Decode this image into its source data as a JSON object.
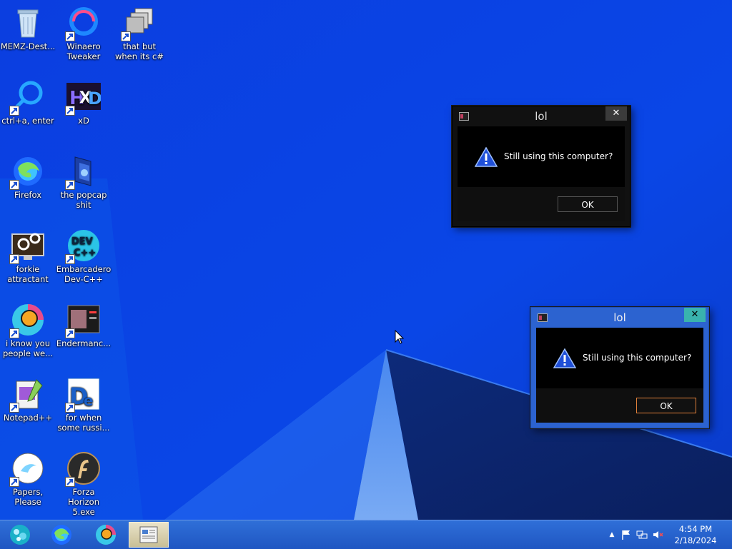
{
  "desktop": {
    "icons": [
      {
        "label": "MEMZ-Dest...",
        "icon": "recycle-bin-icon",
        "shortcut": false
      },
      {
        "label": "Winaero Tweaker",
        "icon": "winaero-tweaker-icon",
        "shortcut": true
      },
      {
        "label": "that but when its c#",
        "icon": "stacked-windows-icon",
        "shortcut": true
      },
      {
        "label": "ctrl+a, enter",
        "icon": "search-ring-icon",
        "shortcut": true
      },
      {
        "label": "xD",
        "icon": "hxd-icon",
        "shortcut": true
      },
      {
        "label": "Firefox",
        "icon": "firefox-icon",
        "shortcut": true
      },
      {
        "label": "the popcap shit",
        "icon": "popcap-folder-icon",
        "shortcut": true
      },
      {
        "label": "forkie attractant",
        "icon": "gear-monitor-icon",
        "shortcut": true
      },
      {
        "label": "Embarcadero Dev-C++",
        "icon": "devcpp-icon",
        "shortcut": true
      },
      {
        "label": "i know you people we...",
        "icon": "colorful-circle-icon",
        "shortcut": true
      },
      {
        "label": "Endermanc...",
        "icon": "endermanch-icon",
        "shortcut": true
      },
      {
        "label": "Notepad++",
        "icon": "notepadpp-icon",
        "shortcut": true
      },
      {
        "label": "for when some russi...",
        "icon": "de-icon",
        "shortcut": true
      },
      {
        "label": "Papers, Please",
        "icon": "papers-please-icon",
        "shortcut": true
      },
      {
        "label": "Forza Horizon 5.exe",
        "icon": "flash-player-icon",
        "shortcut": true
      }
    ]
  },
  "dialogs": [
    {
      "title": "lol",
      "message": "Still using this computer?",
      "ok_label": "OK",
      "close_glyph": "✕",
      "active": false
    },
    {
      "title": "lol",
      "message": "Still using this computer?",
      "ok_label": "OK",
      "close_glyph": "✕",
      "active": true
    }
  ],
  "taskbar": {
    "buttons": [
      "bubble-orb-icon",
      "firefox-icon",
      "colorful-circle-icon",
      "document-window-icon"
    ],
    "tray": {
      "chevron": "▲",
      "icons": [
        "action-center-flag-icon",
        "network-icon",
        "volume-muted-icon"
      ]
    },
    "clock": {
      "time": "4:54 PM",
      "date": "2/18/2024"
    }
  },
  "colors": {
    "wallpaper_blue": "#0a3fd6",
    "dialog_active_frame": "#2c63d0",
    "dialog_close_active": "#39b3ae",
    "ok_focus": "#e0803a",
    "taskbar": "#2f6fd8"
  }
}
